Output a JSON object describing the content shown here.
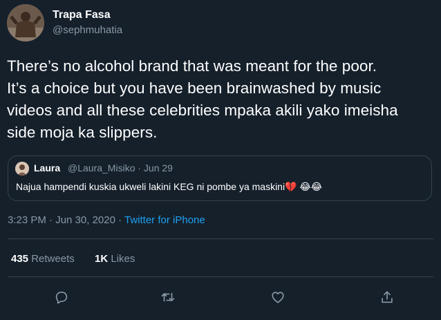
{
  "author": {
    "name": "Trapa Fasa",
    "handle": "@sephmuhatia"
  },
  "tweet": {
    "text": "There’s no alcohol brand that was meant for the poor.\nIt’s a choice but you have been brainwashed by music\nvideos and all these celebrities mpaka akili yako imeisha\nside moja ka slippers."
  },
  "quoted": {
    "name": "Laura",
    "handle_date": "@Laura_Misiko · Jun 29",
    "text": "Najua hampendi kuskia ukweli lakini KEG ni pombe ya maskini💔 😂😂"
  },
  "meta": {
    "time": "3:23 PM · Jun 30, 2020 · ",
    "source": "Twitter for iPhone"
  },
  "stats": {
    "retweets_count": "435",
    "retweets_label": "Retweets",
    "likes_count": "1K",
    "likes_label": "Likes"
  },
  "colors": {
    "background": "#15202b",
    "secondary_text": "#8899a6",
    "link": "#1da1f2",
    "border": "#38444d"
  },
  "icons": [
    "reply-icon",
    "retweet-icon",
    "like-icon",
    "share-icon"
  ]
}
